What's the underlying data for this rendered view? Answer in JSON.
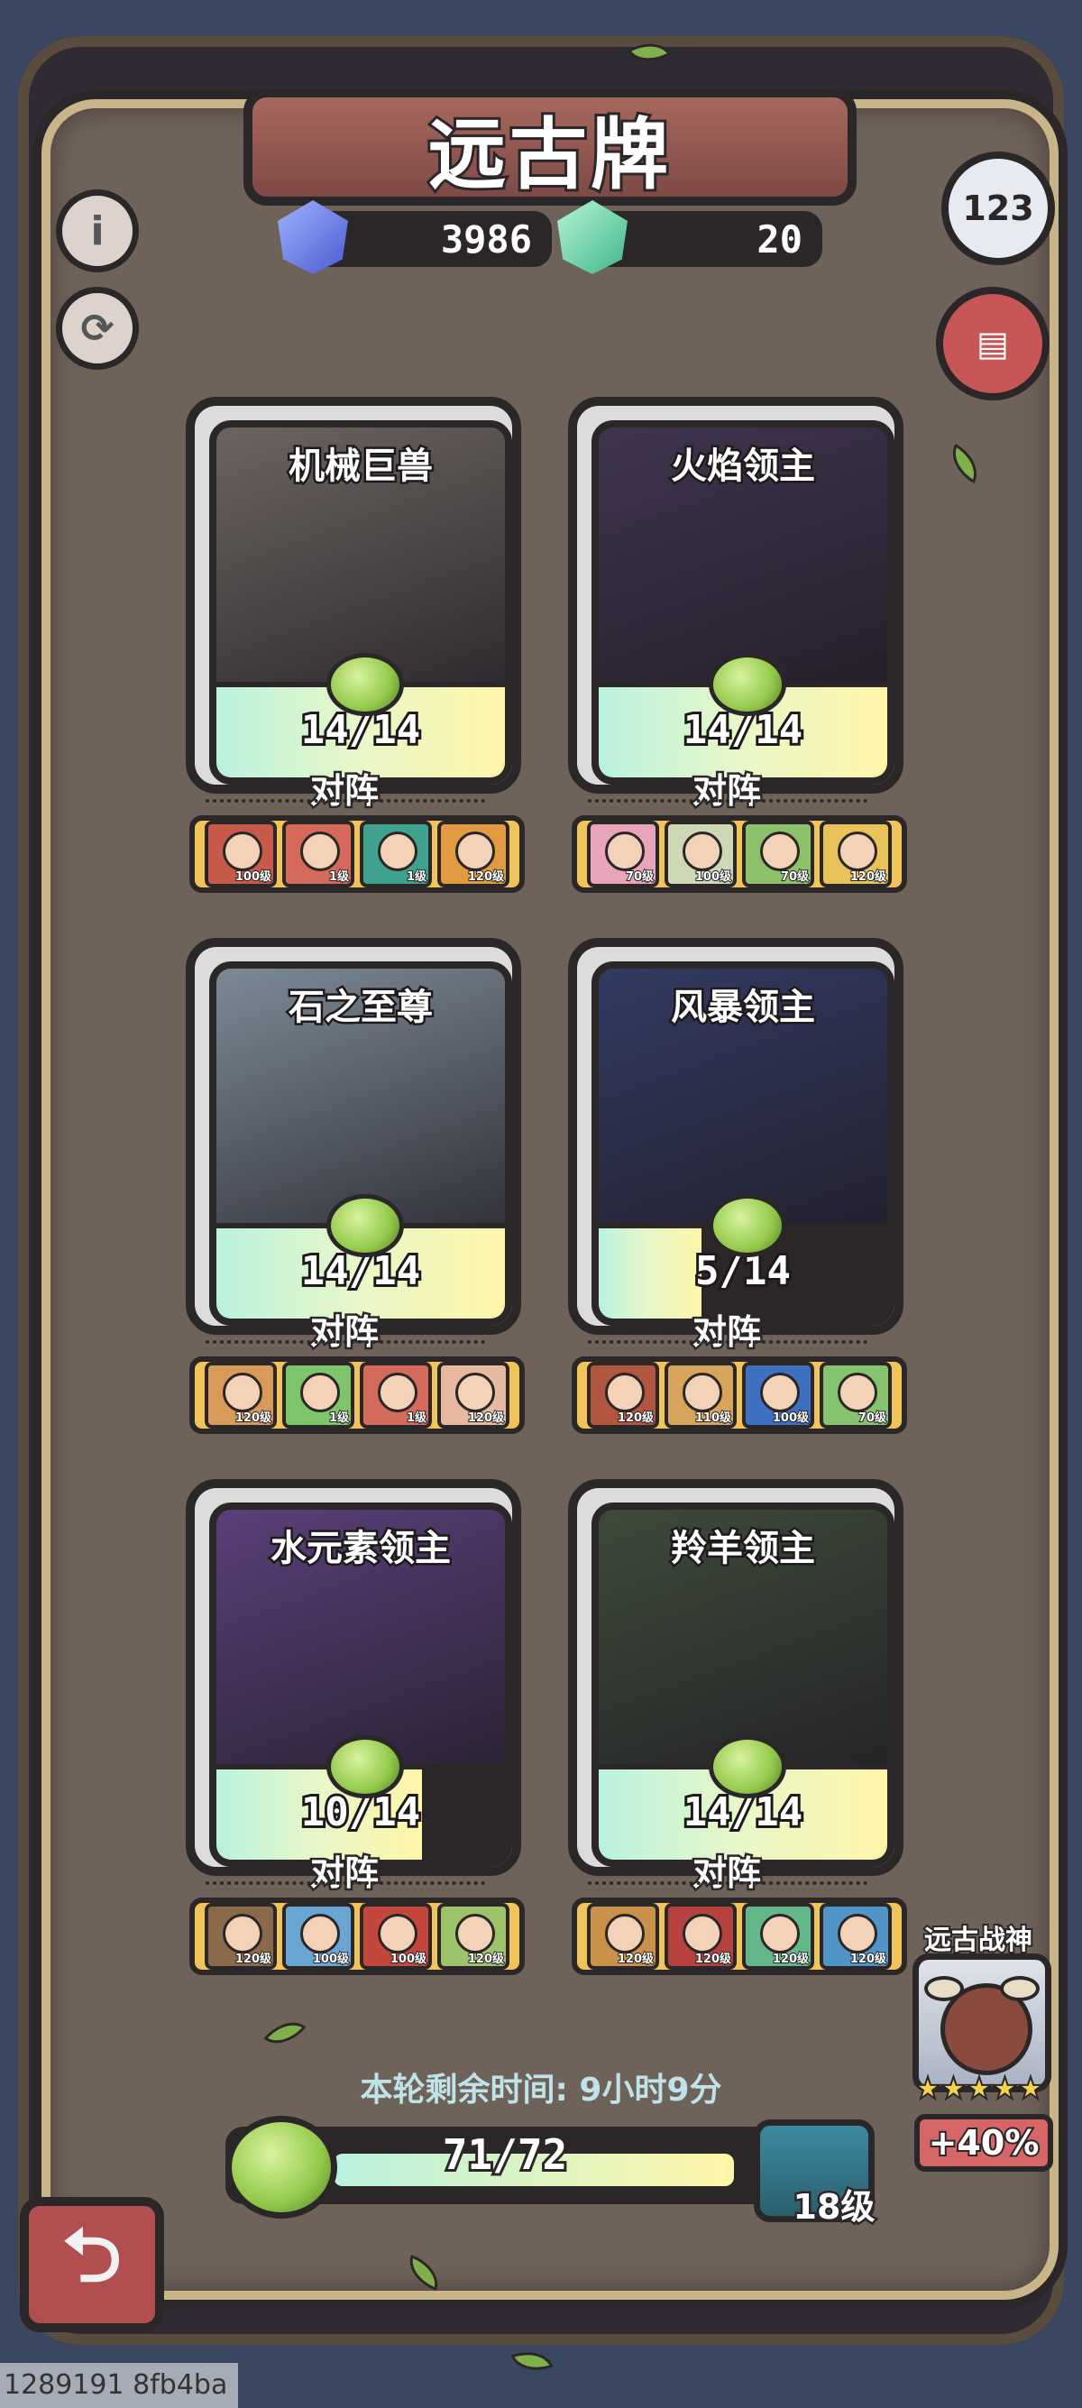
{
  "title": "远古牌",
  "currencies": {
    "blue_gem": "3986",
    "green_gem": "20"
  },
  "top_buttons": {
    "info": "i",
    "ranking": "123"
  },
  "cards": [
    {
      "name": "机械巨兽",
      "count": "14/14",
      "progress": 1.0,
      "lineup_label": "对阵",
      "theme": "#6b6460",
      "lineup": [
        {
          "lvl": "100级",
          "color": "#c85a4a"
        },
        {
          "lvl": "1级",
          "color": "#d66a5a"
        },
        {
          "lvl": "1级",
          "color": "#3fa28e"
        },
        {
          "lvl": "120级",
          "color": "#e19a3f"
        }
      ]
    },
    {
      "name": "火焰领主",
      "count": "14/14",
      "progress": 1.0,
      "lineup_label": "对阵",
      "theme": "#40344f",
      "lineup": [
        {
          "lvl": "70级",
          "color": "#e8a4b8"
        },
        {
          "lvl": "100级",
          "color": "#cfd8b6"
        },
        {
          "lvl": "70级",
          "color": "#8cc16a"
        },
        {
          "lvl": "120级",
          "color": "#e9c25a"
        }
      ]
    },
    {
      "name": "石之至尊",
      "count": "14/14",
      "progress": 1.0,
      "lineup_label": "对阵",
      "theme": "#7c8a96",
      "lineup": [
        {
          "lvl": "120级",
          "color": "#d89a58"
        },
        {
          "lvl": "1级",
          "color": "#7ec46a"
        },
        {
          "lvl": "1级",
          "color": "#d36a5c"
        },
        {
          "lvl": "120级",
          "color": "#e7b9a0"
        }
      ]
    },
    {
      "name": "风暴领主",
      "count": "5/14",
      "progress": 0.357,
      "lineup_label": "对阵",
      "theme": "#323a62",
      "lineup": [
        {
          "lvl": "120级",
          "color": "#b2573f"
        },
        {
          "lvl": "110级",
          "color": "#d7a45c"
        },
        {
          "lvl": "100级",
          "color": "#3f6fbf"
        },
        {
          "lvl": "70级",
          "color": "#86c36e"
        }
      ]
    },
    {
      "name": "水元素领主",
      "count": "10/14",
      "progress": 0.714,
      "lineup_label": "对阵",
      "theme": "#5a3f7a",
      "lineup": [
        {
          "lvl": "120级",
          "color": "#8a6a4a"
        },
        {
          "lvl": "100级",
          "color": "#6aa6d4"
        },
        {
          "lvl": "100级",
          "color": "#c4473e"
        },
        {
          "lvl": "120级",
          "color": "#9cc26a"
        }
      ]
    },
    {
      "name": "羚羊领主",
      "count": "14/14",
      "progress": 1.0,
      "lineup_label": "对阵",
      "theme": "#3e4a3a",
      "lineup": [
        {
          "lvl": "120级",
          "color": "#c9914a"
        },
        {
          "lvl": "120级",
          "color": "#b5423e"
        },
        {
          "lvl": "120级",
          "color": "#63b88a"
        },
        {
          "lvl": "120级",
          "color": "#4f95c8"
        }
      ]
    }
  ],
  "timer_text": "本轮剩余时间: 9小时9分",
  "main_progress": {
    "count": "71/72",
    "progress": 0.986
  },
  "chest_level": "18级",
  "war_god": {
    "title": "远古战神",
    "stars": "★★★★★",
    "bonus": "+40%"
  },
  "back_icon": "back-arrow-icon",
  "debug_text": "1289191 8fb4ba"
}
